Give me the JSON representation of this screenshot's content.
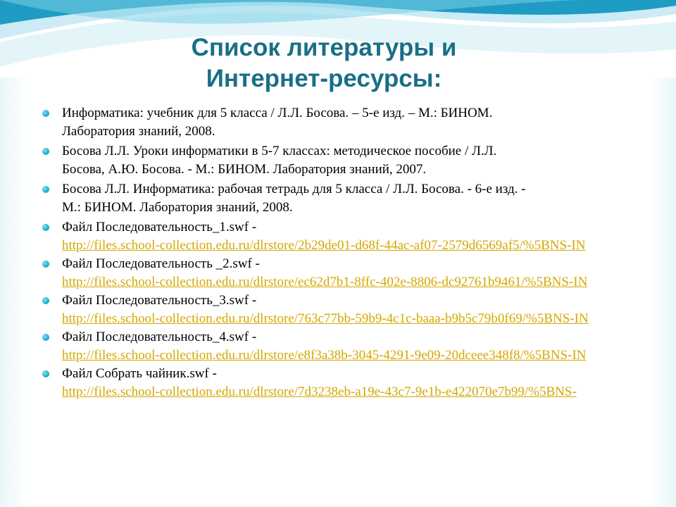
{
  "title": {
    "line1": "Список литературы и",
    "line2": "Интернет-ресурсы:"
  },
  "references": [
    {
      "line1": "Информатика: учебник для 5 класса / Л.Л. Босова. – 5-е изд. – М.: БИНОМ.",
      "line2": "Лаборатория знаний, 2008."
    },
    {
      "line1": "Босова Л.Л. Уроки информатики в 5-7 классах: методическое пособие / Л.Л.",
      "line2": "Босова, А.Ю. Босова. - М.: БИНОМ. Лаборатория знаний, 2007."
    },
    {
      "line1": "Босова Л.Л. Информатика: рабочая тетрадь для 5 класса / Л.Л. Босова. - 6-е изд. -",
      "line2": "М.: БИНОМ. Лаборатория знаний, 2008."
    }
  ],
  "resources": [
    {
      "label": "Файл Последовательность_1.swf  -",
      "url": "http://files.school-collection.edu.ru/dlrstore/2b29de01-d68f-44ac-af07-2579d6569af5/%5BNS-IN"
    },
    {
      "label": "Файл Последовательность _2.swf -",
      "url": "http://files.school-collection.edu.ru/dlrstore/ec62d7b1-8ffc-402e-8806-dc92761b9461/%5BNS-IN"
    },
    {
      "label": "Файл Последовательность_3.swf -",
      "url": "http://files.school-collection.edu.ru/dlrstore/763c77bb-59b9-4c1c-baaa-b9b5c79b0f69/%5BNS-IN"
    },
    {
      "label": "Файл Последовательность_4.swf  -",
      "url": "http://files.school-collection.edu.ru/dlrstore/e8f3a38b-3045-4291-9e09-20dceee348f8/%5BNS-IN"
    },
    {
      "label": "Файл Собрать чайник.swf -",
      "url": "http://files.school-collection.edu.ru/dlrstore/7d3238eb-a19e-43c7-9e1b-e422070e7b99/%5BNS-"
    }
  ],
  "colors": {
    "title": "#1a6f86",
    "link": "#d4a800",
    "bullet": "#1aa8cc",
    "wave_dark": "#1e9cc4",
    "wave_light": "#bfe6f2"
  }
}
